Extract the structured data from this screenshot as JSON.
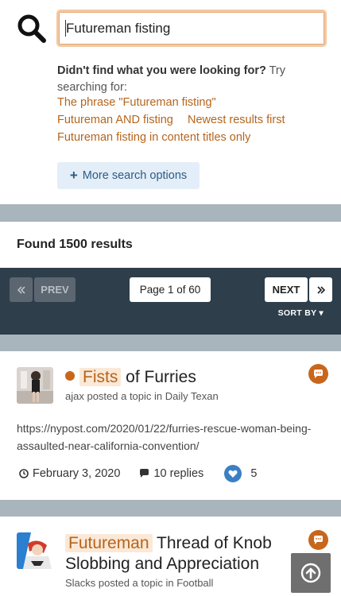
{
  "search": {
    "query": "Futureman fisting",
    "suggest_lead": "Didn't find what you were looking for?",
    "suggest_rest": "Try searching for:",
    "links": [
      "The phrase \"Futureman fisting\"",
      "Futureman AND fisting",
      "Newest results first",
      "Futureman fisting in content titles only"
    ],
    "more_options": "More search options"
  },
  "results_header": "Found 1500 results",
  "pagination": {
    "prev": "PREV",
    "page": "Page 1 of 60",
    "next": "NEXT",
    "sort_by": "SORT BY"
  },
  "results": [
    {
      "title_highlight": "Fists",
      "title_rest": "of Furries",
      "meta": "ajax posted a topic in Daily Texan",
      "snippet": "https://nypost.com/2020/01/22/furries-rescue-woman-being-assaulted-near-california-convention/",
      "date": "February 3, 2020",
      "replies": "10 replies",
      "likes": "5"
    },
    {
      "title_highlight": "Futureman",
      "title_rest": "Thread of Knob Slobbing and Appreciation",
      "meta": "Slacks posted a topic in Football"
    }
  ],
  "colors": {
    "accent": "#b5651d",
    "badge": "#c8661c",
    "pager_bg": "#2e3e4b",
    "separator": "#a9b5bd",
    "like": "#3b7fc4"
  },
  "icons": [
    "search-icon",
    "plus-icon",
    "double-chevron-left-icon",
    "double-chevron-right-icon",
    "caret-down-icon",
    "unread-dot-icon",
    "comments-icon",
    "clock-icon",
    "comment-icon",
    "heart-icon",
    "arrow-up-icon"
  ]
}
